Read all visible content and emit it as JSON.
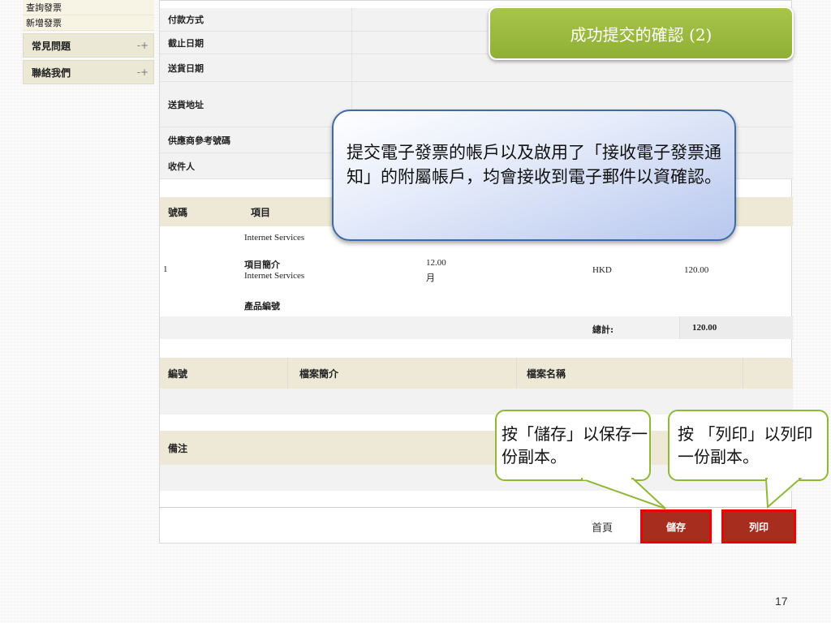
{
  "sidebar": {
    "links": [
      "查詢發票",
      "新增發票"
    ],
    "items": [
      {
        "label": "常見問題",
        "icon": "plus-arrow-icon"
      },
      {
        "label": "聯絡我們",
        "icon": "plus-arrow-icon"
      }
    ],
    "plus_glyph": "-+"
  },
  "info_rows": [
    "付款方式",
    "截止日期",
    "送貨日期",
    "送貨地址",
    "供應商參考號碼",
    "收件人"
  ],
  "items_table": {
    "headers": [
      "號碼",
      "項目"
    ],
    "row_name": "Internet Services",
    "number": "1",
    "desc_label": "項目簡介",
    "desc_value": "Internet Services",
    "quantity": "12.00",
    "unit": "月",
    "currency": "HKD",
    "amount": "120.00",
    "product_code_label": "產品編號",
    "total_label": "總計:",
    "total_value": "120.00"
  },
  "attachments_table": {
    "headers": [
      "編號",
      "檔案簡介",
      "檔案名稱"
    ]
  },
  "remarks_label": "備注",
  "buttons": {
    "home": "首頁",
    "save": "儲存",
    "print": "列印"
  },
  "callouts": {
    "title": "成功提交的確認 (2)",
    "info": "提交電子發票的帳戶以及啟用了「接收電子發票通知」的附屬帳戶，均會接收到電子郵件以資確認。",
    "save_tip": "按「儲存」以保存一份副本。",
    "print_tip": "按 「列印」以列印一份副本。"
  },
  "page_number": "17",
  "colors": {
    "title_green": "#9bbb41",
    "button_red": "#a72d1f",
    "highlight_red": "#ee0000",
    "callout_blue": "#3e6aa8"
  }
}
